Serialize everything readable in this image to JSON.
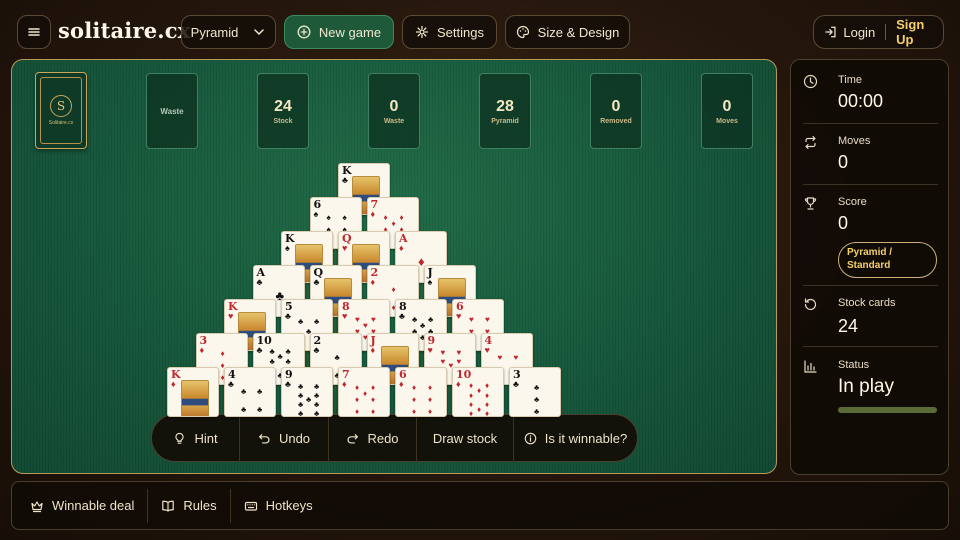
{
  "header": {
    "logo": "solitaire.cx",
    "mode_label": "Pyramid",
    "new_game_label": "New game",
    "settings_label": "Settings",
    "design_label": "Size & Design",
    "login_label": "Login",
    "signup_label": "Sign Up"
  },
  "board": {
    "stock_card_brand": "Solitaire.cx",
    "stock_card_monogram": "S",
    "waste_label": "Waste",
    "counters": [
      {
        "value": "24",
        "label": "Stock"
      },
      {
        "value": "0",
        "label": "Waste"
      },
      {
        "value": "28",
        "label": "Pyramid"
      },
      {
        "value": "0",
        "label": "Removed"
      },
      {
        "value": "0",
        "label": "Moves"
      }
    ],
    "pyramid_rows": [
      [
        {
          "rank": "K",
          "suit": "♣"
        }
      ],
      [
        {
          "rank": "6",
          "suit": "♠"
        },
        {
          "rank": "7",
          "suit": "♦"
        }
      ],
      [
        {
          "rank": "K",
          "suit": "♠"
        },
        {
          "rank": "Q",
          "suit": "♥"
        },
        {
          "rank": "A",
          "suit": "♦"
        }
      ],
      [
        {
          "rank": "A",
          "suit": "♣"
        },
        {
          "rank": "Q",
          "suit": "♣"
        },
        {
          "rank": "2",
          "suit": "♦"
        },
        {
          "rank": "J",
          "suit": "♠"
        }
      ],
      [
        {
          "rank": "K",
          "suit": "♥"
        },
        {
          "rank": "5",
          "suit": "♣"
        },
        {
          "rank": "8",
          "suit": "♥"
        },
        {
          "rank": "8",
          "suit": "♣"
        },
        {
          "rank": "6",
          "suit": "♥"
        }
      ],
      [
        {
          "rank": "3",
          "suit": "♦"
        },
        {
          "rank": "10",
          "suit": "♣"
        },
        {
          "rank": "2",
          "suit": "♣"
        },
        {
          "rank": "J",
          "suit": "♦"
        },
        {
          "rank": "9",
          "suit": "♥"
        },
        {
          "rank": "4",
          "suit": "♥"
        }
      ],
      [
        {
          "rank": "K",
          "suit": "♦"
        },
        {
          "rank": "4",
          "suit": "♣"
        },
        {
          "rank": "9",
          "suit": "♣"
        },
        {
          "rank": "7",
          "suit": "♦"
        },
        {
          "rank": "6",
          "suit": "♦"
        },
        {
          "rank": "10",
          "suit": "♦"
        },
        {
          "rank": "3",
          "suit": "♣"
        }
      ]
    ]
  },
  "actions": {
    "hint": "Hint",
    "undo": "Undo",
    "redo": "Redo",
    "draw_stock": "Draw stock",
    "winnable": "Is it winnable?"
  },
  "sidebar": {
    "time_label": "Time",
    "time_value": "00:00",
    "moves_label": "Moves",
    "moves_value": "0",
    "score_label": "Score",
    "score_value": "0",
    "mode_pill": "Pyramid / Standard",
    "stock_label": "Stock cards",
    "stock_value": "24",
    "status_label": "Status",
    "status_value": "In play",
    "status_progress": 1.0
  },
  "footer": {
    "winnable_deal": "Winnable deal",
    "rules": "Rules",
    "hotkeys": "Hotkeys"
  },
  "colors": {
    "felt": "#15563a",
    "accent_gold": "#f4cf6a",
    "primary_button": "#1e5a3a",
    "red_suit": "#c1272d"
  },
  "icons": {
    "menu": "hamburger-icon",
    "new_game": "plus-circle-icon",
    "settings": "gear-icon",
    "design": "palette-icon",
    "login": "login-icon",
    "hint": "lightbulb-icon",
    "undo": "undo-icon",
    "redo": "redo-icon",
    "info": "info-icon",
    "time": "clock-icon",
    "moves": "repeat-icon",
    "score": "trophy-icon",
    "stock": "refresh-icon",
    "status": "bar-chart-icon",
    "winnable": "crown-icon",
    "rules": "book-icon",
    "hotkeys": "keyboard-icon"
  }
}
